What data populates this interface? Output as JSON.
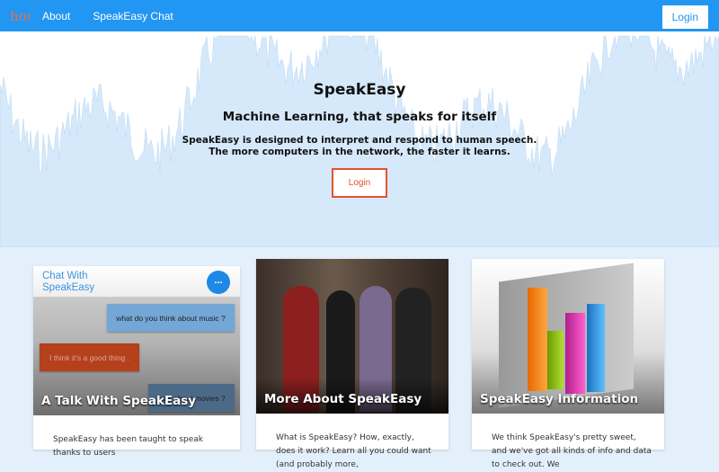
{
  "nav": {
    "brand": "home",
    "links": [
      "About",
      "SpeakEasy Chat"
    ],
    "login": "Login"
  },
  "hero": {
    "title": "SpeakEasy",
    "subtitle": "Machine Learning, that speaks for itself",
    "line1": "SpeakEasy is designed to interpret and respond to human speech.",
    "line2": "The more computers in the network, the faster it learns.",
    "login": "Login"
  },
  "cards": [
    {
      "header": "Chat With SpeakEasy",
      "menu": "...",
      "bubbles": [
        "what do you think about music ?",
        "I think it's a good thing .",
        "how about movies ?"
      ],
      "title": "A Talk With SpeakEasy",
      "text": "SpeakEasy has been taught to speak thanks to users"
    },
    {
      "title": "More About SpeakEasy",
      "text": "What is SpeakEasy? How, exactly, does it work? Learn all you could want (and probably more,"
    },
    {
      "title": "SpeakEasy Information",
      "text": "We think SpeakEasy's pretty sweet, and we've got all kinds of info and data to check out. We"
    }
  ],
  "colors": {
    "nav": "#2196f3",
    "accent": "#e5522b",
    "wave": "#d6e9fb"
  }
}
